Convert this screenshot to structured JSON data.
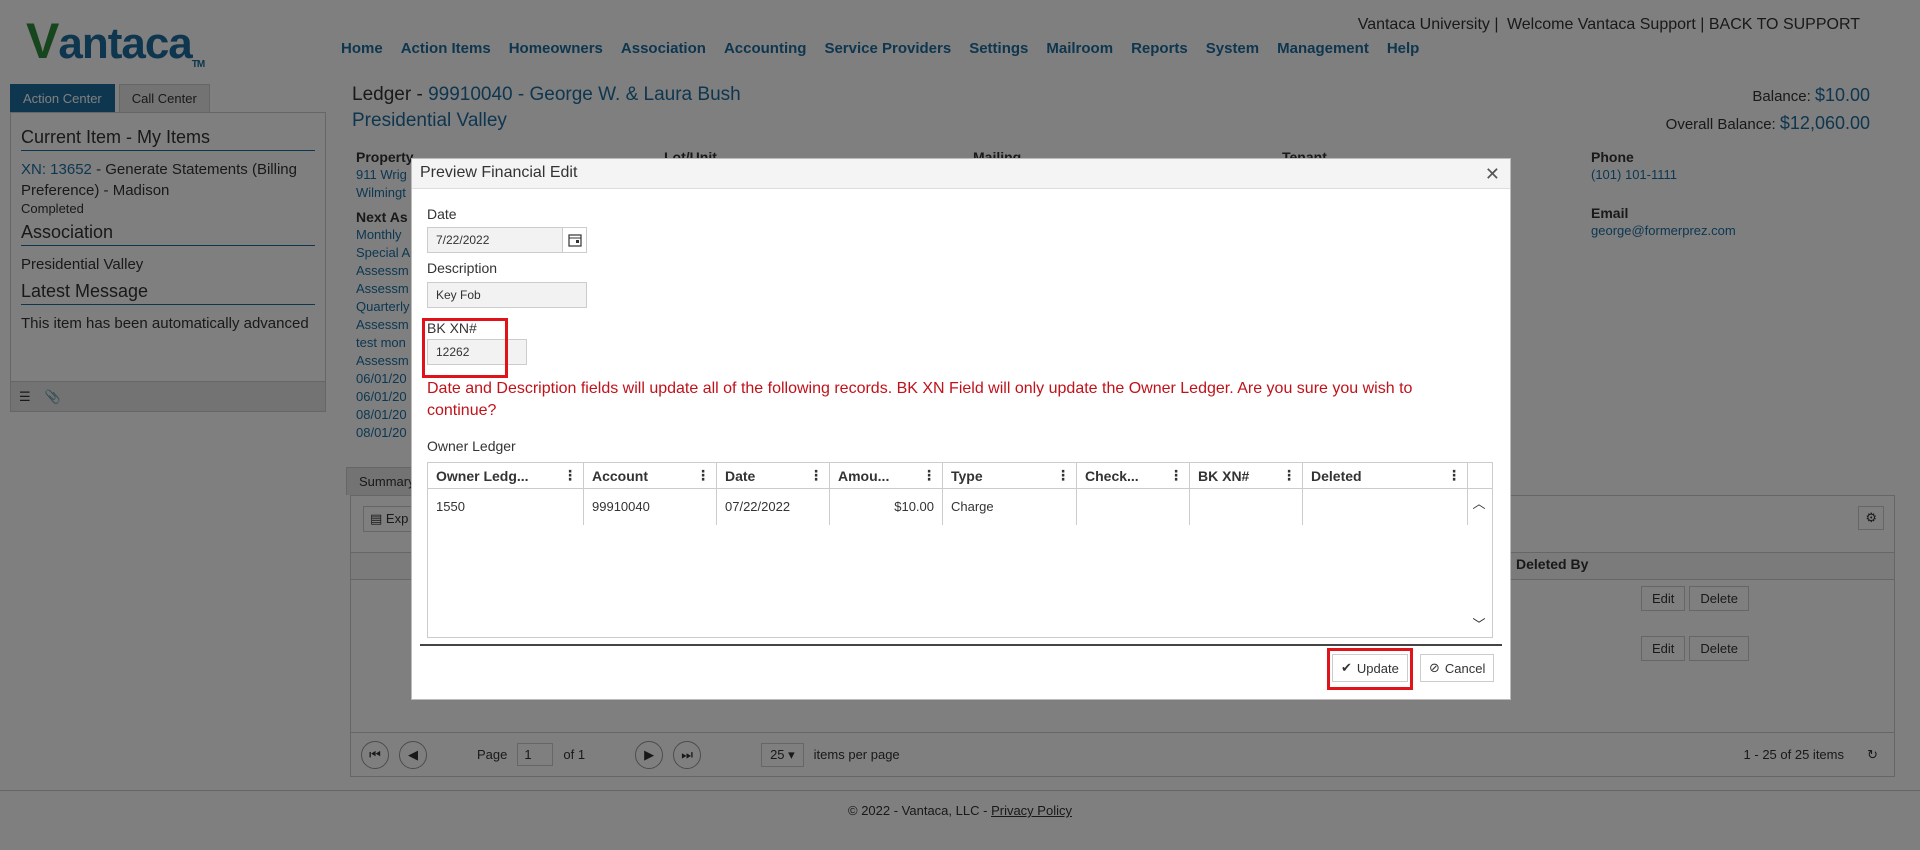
{
  "header": {
    "logo": "Vantaca",
    "top_links": [
      "Vantaca University",
      "Welcome Vantaca Support",
      "BACK TO SUPPORT"
    ],
    "nav": [
      "Home",
      "Action Items",
      "Homeowners",
      "Association",
      "Accounting",
      "Service Providers",
      "Settings",
      "Mailroom",
      "Reports",
      "System",
      "Management",
      "Help"
    ]
  },
  "left_panel": {
    "tabs": [
      "Action Center",
      "Call Center"
    ],
    "current_item_heading": "Current Item - My Items",
    "current_item_link": "XN: 13652",
    "current_item_text": "- Generate Statements (Billing Preference) - Madison",
    "current_item_status": "Completed",
    "association_heading": "Association",
    "association_link": "Presidential Valley",
    "latest_message_heading": "Latest Message",
    "latest_message": "This item has been automatically advanced"
  },
  "main": {
    "ledger_prefix": "Ledger -",
    "ledger_account": "99910040 - George W. & Laura Bush",
    "ledger_assoc": "Presidential Valley",
    "balance_label": "Balance:",
    "balance_value": "$10.00",
    "overall_balance_label": "Overall Balance:",
    "overall_balance_value": "$12,060.00",
    "cols": {
      "property_label": "Property",
      "property_lines": [
        "911 Wrig",
        "Wilmingt"
      ],
      "lot_label": "Lot/Unit",
      "mailing_label": "Mailing",
      "tenant_label": "Tenant",
      "phone_label": "Phone",
      "phone_value": "(101) 101-1111",
      "next_label": "Next As",
      "email_label": "Email",
      "email_value": "george@formerprez.com",
      "next_lines": [
        "Monthly",
        "Special A",
        "Assessm",
        "Assessm",
        "Quarterly",
        "Assessm",
        "test mon",
        "Assessm",
        "06/01/20",
        "06/01/20",
        "08/01/20",
        "08/01/20"
      ]
    },
    "bg_tab": "Summary",
    "bg_export": "Exp",
    "bg_deleted_by": "Deleted By",
    "bg_edit": "Edit",
    "bg_delete": "Delete",
    "pager": {
      "page_label": "Page",
      "page_value": "1",
      "of_label": "of 1",
      "per_page_value": "25",
      "per_page_label": "items per page",
      "count_label": "1 - 25 of 25 items"
    }
  },
  "footer": {
    "copyright": "© 2022 - Vantaca, LLC -",
    "privacy": "Privacy Policy"
  },
  "modal": {
    "title": "Preview Financial Edit",
    "date_label": "Date",
    "date_value": "7/22/2022",
    "description_label": "Description",
    "description_value": "Key Fob",
    "bk_label": "BK XN#",
    "bk_value": "12262",
    "warning": "Date and Description fields will update all of the following records. BK XN Field will only update the Owner Ledger. Are you sure you wish to continue?",
    "owner_ledger_label": "Owner Ledger",
    "columns": [
      "Owner Ledg...",
      "Account",
      "Date",
      "Amou...",
      "Type",
      "Check...",
      "BK XN#",
      "Deleted"
    ],
    "row": [
      "1550",
      "99910040",
      "07/22/2022",
      "$10.00",
      "Charge",
      "",
      "",
      ""
    ],
    "update_label": "Update",
    "cancel_label": "Cancel"
  }
}
